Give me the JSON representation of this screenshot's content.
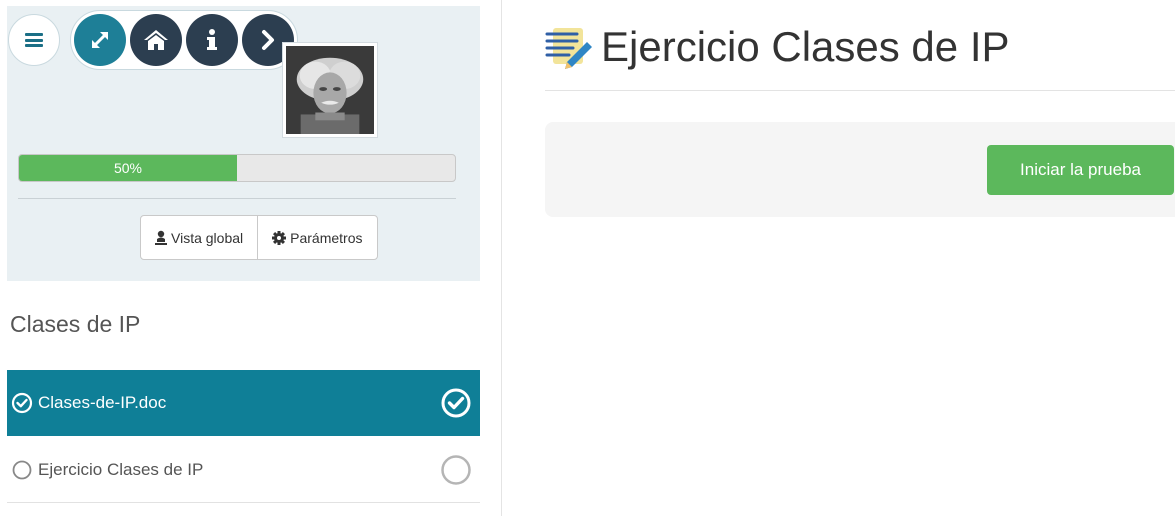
{
  "sidebar": {
    "progress": {
      "value": 0.5,
      "label": "50%"
    },
    "buttons": {
      "overview": "Vista global",
      "settings": "Parámetros"
    },
    "section_title": "Clases de IP",
    "items": [
      {
        "label": "Clases-de-IP.doc",
        "status": "completed",
        "active": true
      },
      {
        "label": "Ejercicio Clases de IP",
        "status": "not-started",
        "active": false
      }
    ]
  },
  "main": {
    "title": "Ejercicio Clases de IP",
    "start_button": "Iniciar la prueba"
  },
  "colors": {
    "accent": "#0f7f97",
    "success": "#5cb85c",
    "nav_dark": "#2c3e50",
    "sidebar_bg": "#e9f0f3"
  },
  "icons": [
    "menu-icon",
    "fullscreen-icon",
    "home-icon",
    "info-icon",
    "next-icon",
    "user-icon",
    "cog-icon",
    "check-circle-icon",
    "empty-circle-icon",
    "exercise-icon"
  ]
}
